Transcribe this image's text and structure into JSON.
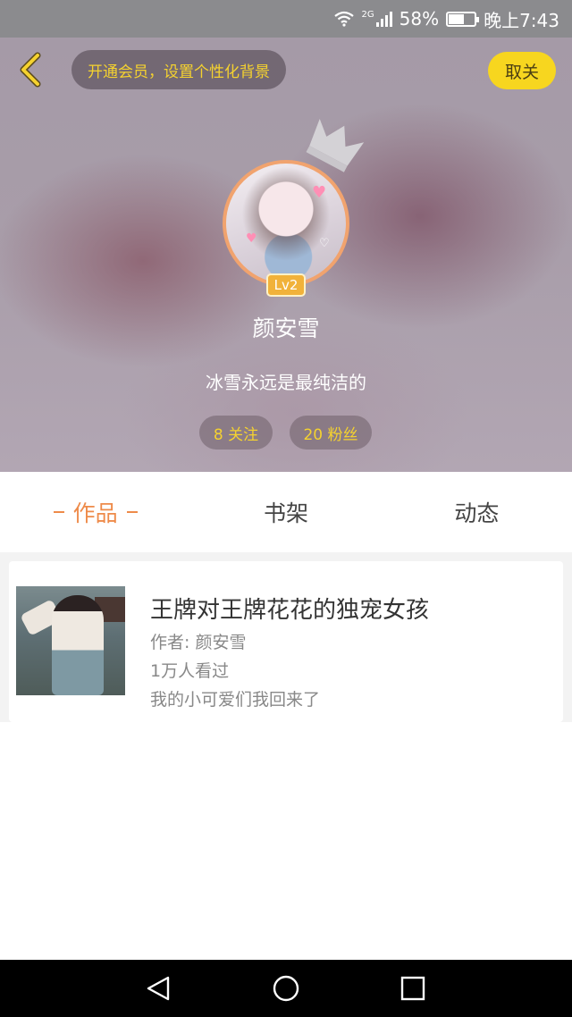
{
  "status_bar": {
    "network": "2G",
    "battery_percent": "58%",
    "battery_level": 0.58,
    "time": "晚上7:43",
    "icons": [
      "wifi-icon",
      "signal-icon",
      "battery-icon"
    ]
  },
  "header": {
    "back_icon": "chevron-left-icon",
    "vip_prompt": "开通会员，设置个性化背景",
    "unfollow_label": "取关",
    "crown_icon": "crown-icon"
  },
  "profile": {
    "level": "Lv2",
    "name": "颜安雪",
    "bio": "冰雪永远是最纯洁的",
    "following": "8 关注",
    "followers": "20 粉丝"
  },
  "tabs": [
    {
      "label": "作品",
      "active": true
    },
    {
      "label": "书架",
      "active": false
    },
    {
      "label": "动态",
      "active": false
    }
  ],
  "works": [
    {
      "title": "王牌对王牌花花的独宠女孩",
      "author": "作者: 颜安雪",
      "views": "1万人看过",
      "description": "我的小可爱们我回来了"
    }
  ],
  "nav_bar": {
    "icons": [
      "back-triangle-icon",
      "home-circle-icon",
      "recent-square-icon"
    ]
  },
  "colors": {
    "accent_orange": "#ee8b4a",
    "accent_yellow": "#f5d22f",
    "button_yellow": "#f7d61f"
  }
}
